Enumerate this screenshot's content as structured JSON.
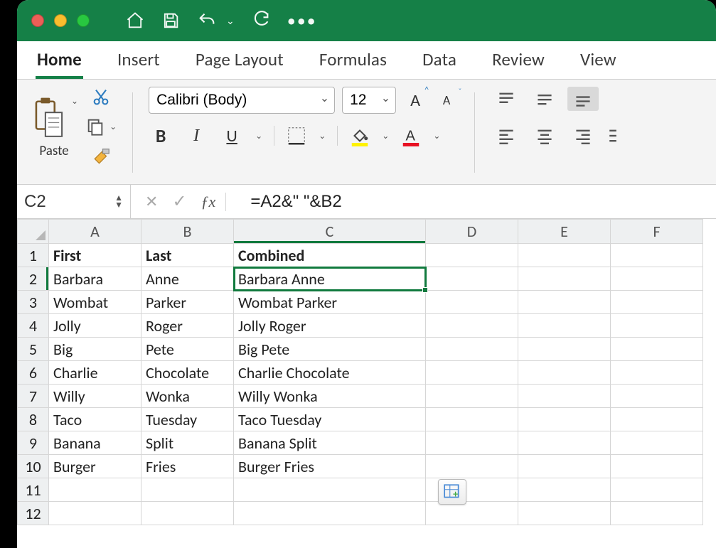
{
  "tabs": {
    "home": "Home",
    "insert": "Insert",
    "page_layout": "Page Layout",
    "formulas": "Formulas",
    "data": "Data",
    "review": "Review",
    "view": "View"
  },
  "clipboard": {
    "paste_label": "Paste"
  },
  "font": {
    "name": "Calibri (Body)",
    "size": "12"
  },
  "namebox": "C2",
  "formula": "=A2&\" \"&B2",
  "columns": [
    "A",
    "B",
    "C",
    "D",
    "E",
    "F"
  ],
  "rows": [
    {
      "n": "1",
      "a": "First",
      "b": "Last",
      "c": "Combined",
      "bold": true
    },
    {
      "n": "2",
      "a": "Barbara",
      "b": "Anne",
      "c": "Barbara Anne"
    },
    {
      "n": "3",
      "a": "Wombat",
      "b": "Parker",
      "c": "Wombat Parker"
    },
    {
      "n": "4",
      "a": "Jolly",
      "b": "Roger",
      "c": "Jolly Roger"
    },
    {
      "n": "5",
      "a": "Big",
      "b": "Pete",
      "c": "Big Pete"
    },
    {
      "n": "6",
      "a": "Charlie",
      "b": "Chocolate",
      "c": "Charlie Chocolate"
    },
    {
      "n": "7",
      "a": "Willy",
      "b": "Wonka",
      "c": "Willy Wonka"
    },
    {
      "n": "8",
      "a": "Taco",
      "b": "Tuesday",
      "c": "Taco Tuesday"
    },
    {
      "n": "9",
      "a": "Banana",
      "b": "Split",
      "c": "Banana Split"
    },
    {
      "n": "10",
      "a": "Burger",
      "b": "Fries",
      "c": "Burger Fries"
    },
    {
      "n": "11",
      "a": "",
      "b": "",
      "c": ""
    },
    {
      "n": "12",
      "a": "",
      "b": "",
      "c": ""
    }
  ],
  "active": {
    "col": "C",
    "row": "2"
  }
}
